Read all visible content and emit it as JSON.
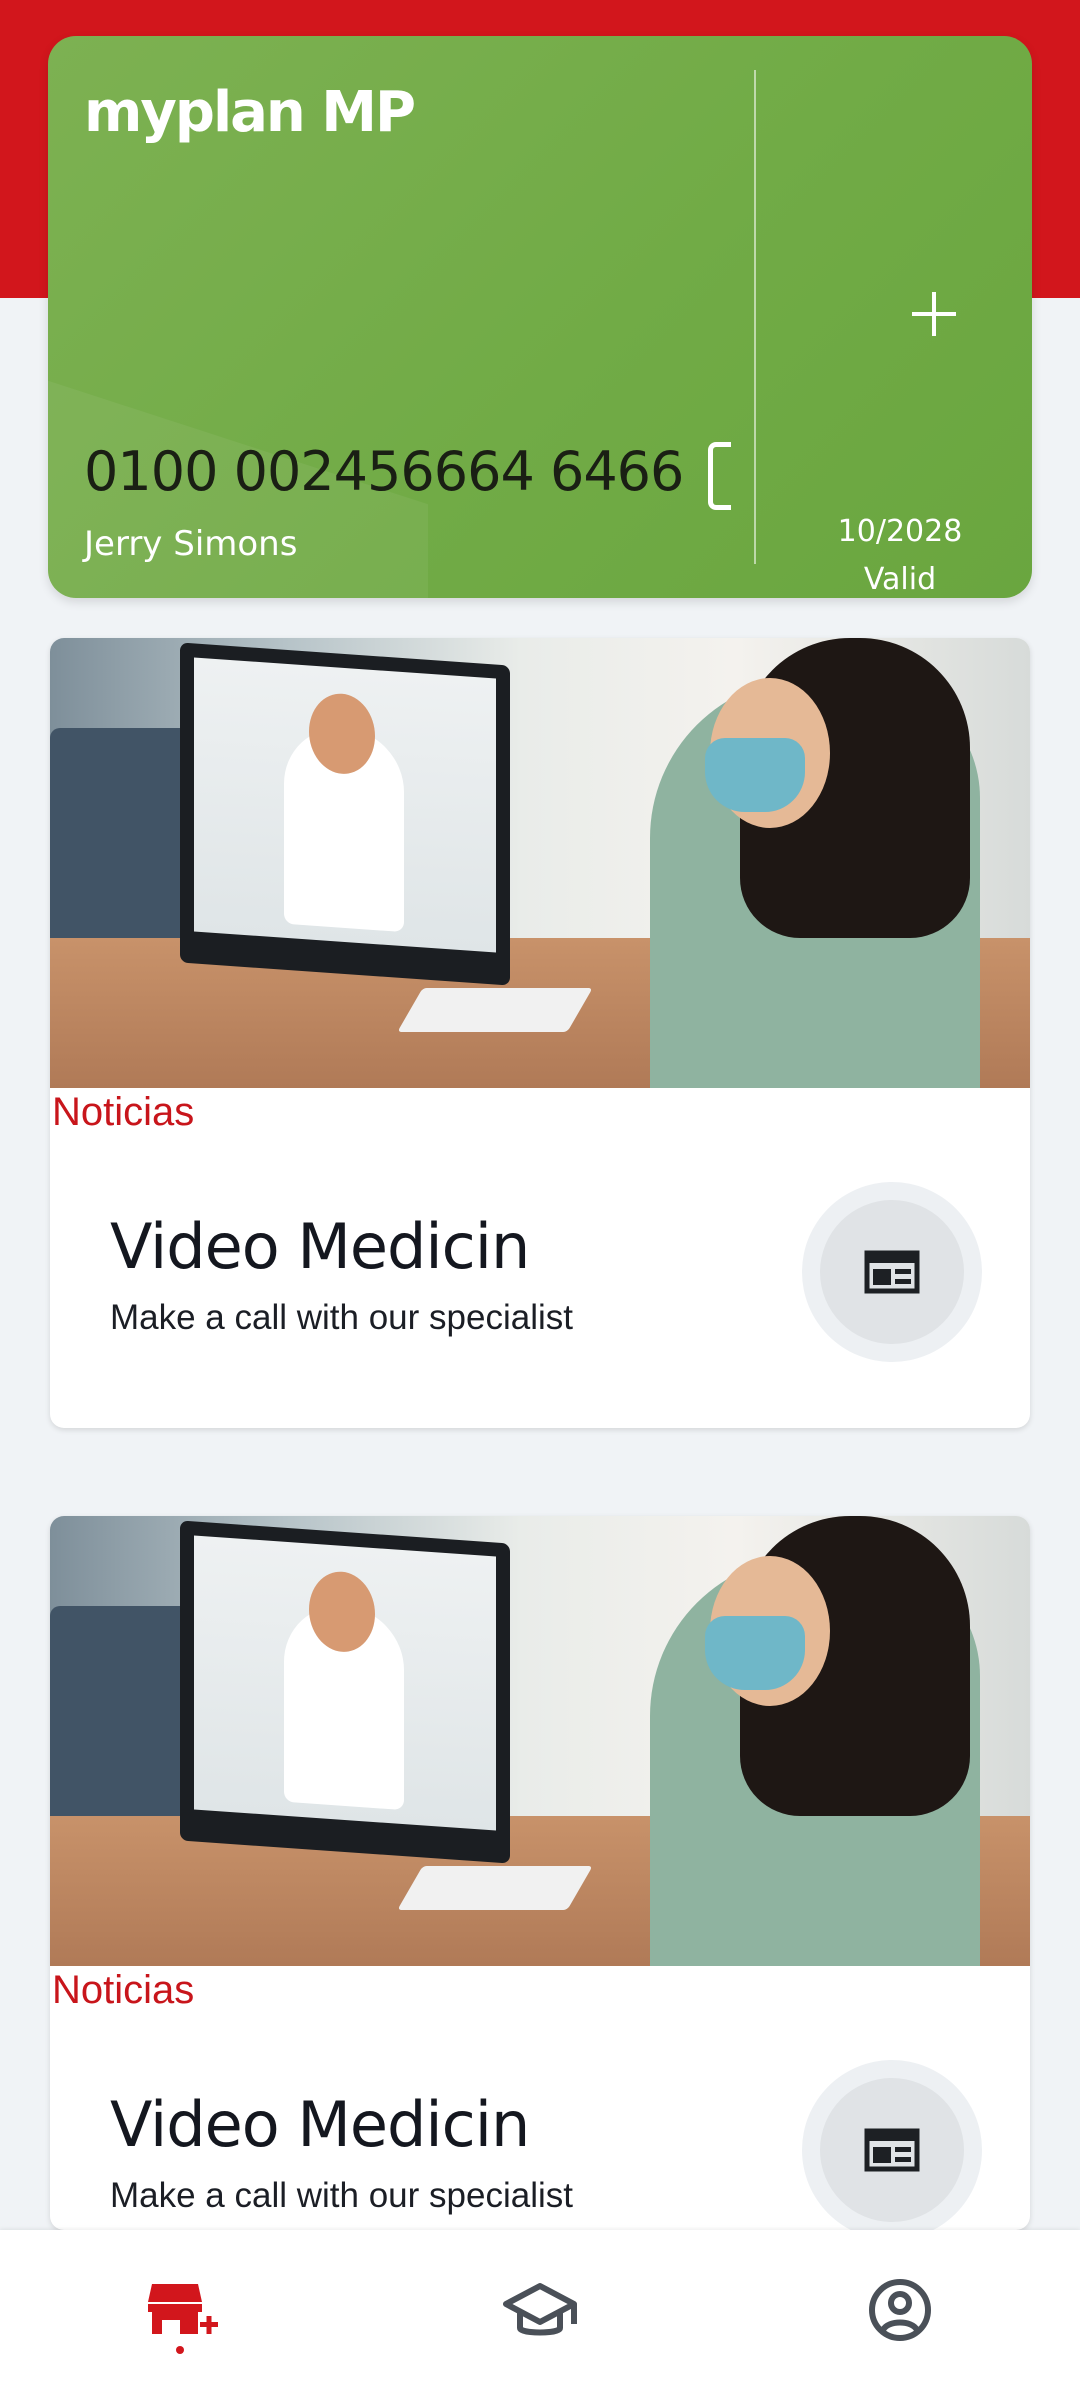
{
  "card": {
    "logo": "myplan MP",
    "number": "0100 002456664 6466",
    "holder": "Jerry Simons",
    "expiry": "10/2028",
    "status": "Valid",
    "color": "#72ac47"
  },
  "cards": [
    {
      "category": "Noticias",
      "title": "Video Medicin",
      "subtitle": "Make a call with our specialist"
    },
    {
      "category": "Noticias",
      "title": "Video Medicin",
      "subtitle": "Make a call with our specialist"
    }
  ],
  "colors": {
    "accent": "#d2161c",
    "icon_gray": "#4a5058"
  },
  "nav": {
    "items": [
      {
        "icon": "store-icon",
        "active": true
      },
      {
        "icon": "graduation-cap-icon",
        "active": false
      },
      {
        "icon": "profile-icon",
        "active": false
      }
    ]
  }
}
